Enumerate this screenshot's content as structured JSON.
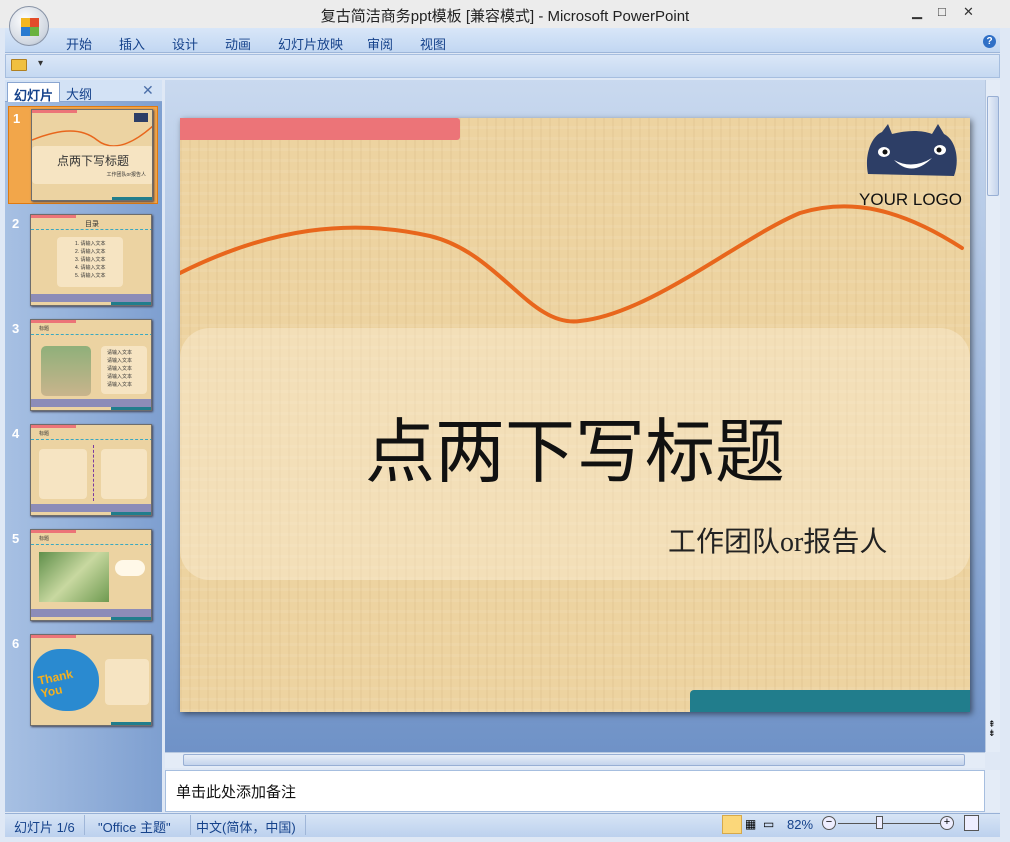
{
  "window": {
    "title": "复古简洁商务ppt模板 [兼容模式] - Microsoft PowerPoint",
    "minimize": "▁",
    "maximize": "□",
    "close": "✕",
    "help": "?"
  },
  "ribbon": {
    "tabs": [
      "开始",
      "插入",
      "设计",
      "动画",
      "幻灯片放映",
      "审阅",
      "视图"
    ]
  },
  "qat": {
    "open_icon": "folder-open-icon",
    "dropdown": "▾"
  },
  "panel": {
    "tabs": [
      "幻灯片",
      "大纲"
    ],
    "close": "✕",
    "selected": 1
  },
  "thumbnails": [
    {
      "num": "1",
      "title": "点两下写标题",
      "sub": "工作团队or报告人"
    },
    {
      "num": "2",
      "title": "目录",
      "items": [
        "1. 请输入文本",
        "2. 请输入文本",
        "3. 请输入文本",
        "4. 请输入文本",
        "5. 请输入文本"
      ]
    },
    {
      "num": "3",
      "title": "标题",
      "items": [
        "请输入文本",
        "请输入文本",
        "请输入文本",
        "请输入文本",
        "请输入文本"
      ]
    },
    {
      "num": "4",
      "title": "标题"
    },
    {
      "num": "5",
      "title": "标题"
    },
    {
      "num": "6",
      "title": "Thank You"
    }
  ],
  "slide": {
    "title": "点两下写标题",
    "subtitle": "工作团队or报告人",
    "logo_text": "YOUR LOGO",
    "colors": {
      "pink": "#ec7478",
      "teal": "#217d8c",
      "curve": "#e8661c",
      "paper": "#edd3a0"
    }
  },
  "notes": {
    "placeholder": "单击此处添加备注"
  },
  "status": {
    "slide": "幻灯片 1/6",
    "theme": "\"Office 主题\"",
    "language": "中文(简体，中国)",
    "zoom": "82%",
    "zoom_percent": 82
  }
}
